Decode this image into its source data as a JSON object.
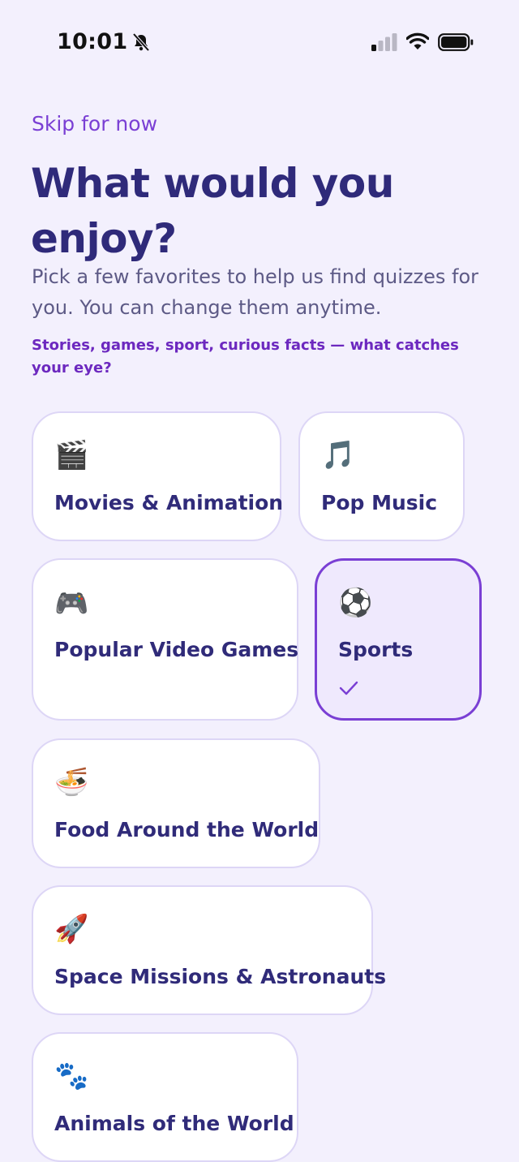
{
  "status_bar": {
    "time": "10:01"
  },
  "skip_label": "Skip for now",
  "title": "What would you enjoy?",
  "subtitle": "Pick a few favorites to help us find quizzes for you. You can change them anytime.",
  "prompt": "Stories, games, sport, curious facts — what catches your eye?",
  "topics": [
    {
      "label": "Movies & Animation",
      "icon": "🎬",
      "icon_name": "clapper-board-icon",
      "selected": false
    },
    {
      "label": "Pop Music",
      "icon": "🎵",
      "icon_name": "music-note-icon",
      "selected": false
    },
    {
      "label": "Popular Video Games",
      "icon": "🎮",
      "icon_name": "game-controller-icon",
      "selected": false
    },
    {
      "label": "Sports",
      "icon": "⚽",
      "icon_name": "soccer-ball-icon",
      "selected": true
    },
    {
      "label": "Food Around the World",
      "icon": "🍜",
      "icon_name": "noodle-bowl-icon",
      "selected": false
    },
    {
      "label": "Space Missions & Astronauts",
      "icon": "🚀",
      "icon_name": "rocket-icon",
      "selected": false
    },
    {
      "label": "Animals of the World",
      "icon": "🐾",
      "icon_name": "paw-prints-icon",
      "selected": false
    }
  ],
  "colors": {
    "background": "#f3f0fd",
    "accent": "#7a3fd4",
    "title": "#2f2a7a",
    "tile_border": "#ddd6f6",
    "selected_tile_bg": "#efe9fd"
  }
}
